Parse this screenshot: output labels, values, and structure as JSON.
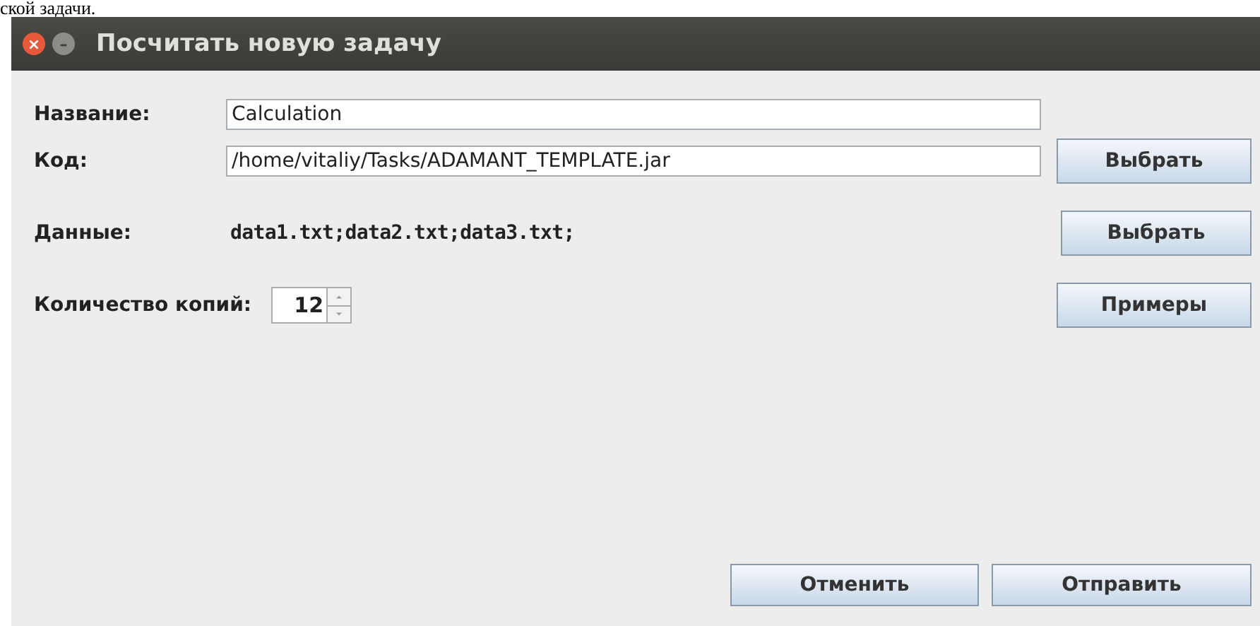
{
  "page_text": "ской задачи.",
  "window": {
    "title": "Посчитать новую задачу",
    "controls": [
      {
        "kind": "close",
        "label": "×"
      },
      {
        "kind": "minimize",
        "label": "–"
      }
    ]
  },
  "form": {
    "name": {
      "label": "Название:",
      "value": "Calculation"
    },
    "code": {
      "label": "Код:",
      "value": "/home/vitaliy/Tasks/ADAMANT_TEMPLATE.jar",
      "button": "Выбрать"
    },
    "data": {
      "label": "Данные:",
      "value": "data1.txt;data2.txt;data3.txt;",
      "button": "Выбрать"
    },
    "copies": {
      "label": "Количество копий:",
      "value": "12",
      "button": "Примеры"
    }
  },
  "buttons": [
    "Отменить",
    "Отправить"
  ]
}
